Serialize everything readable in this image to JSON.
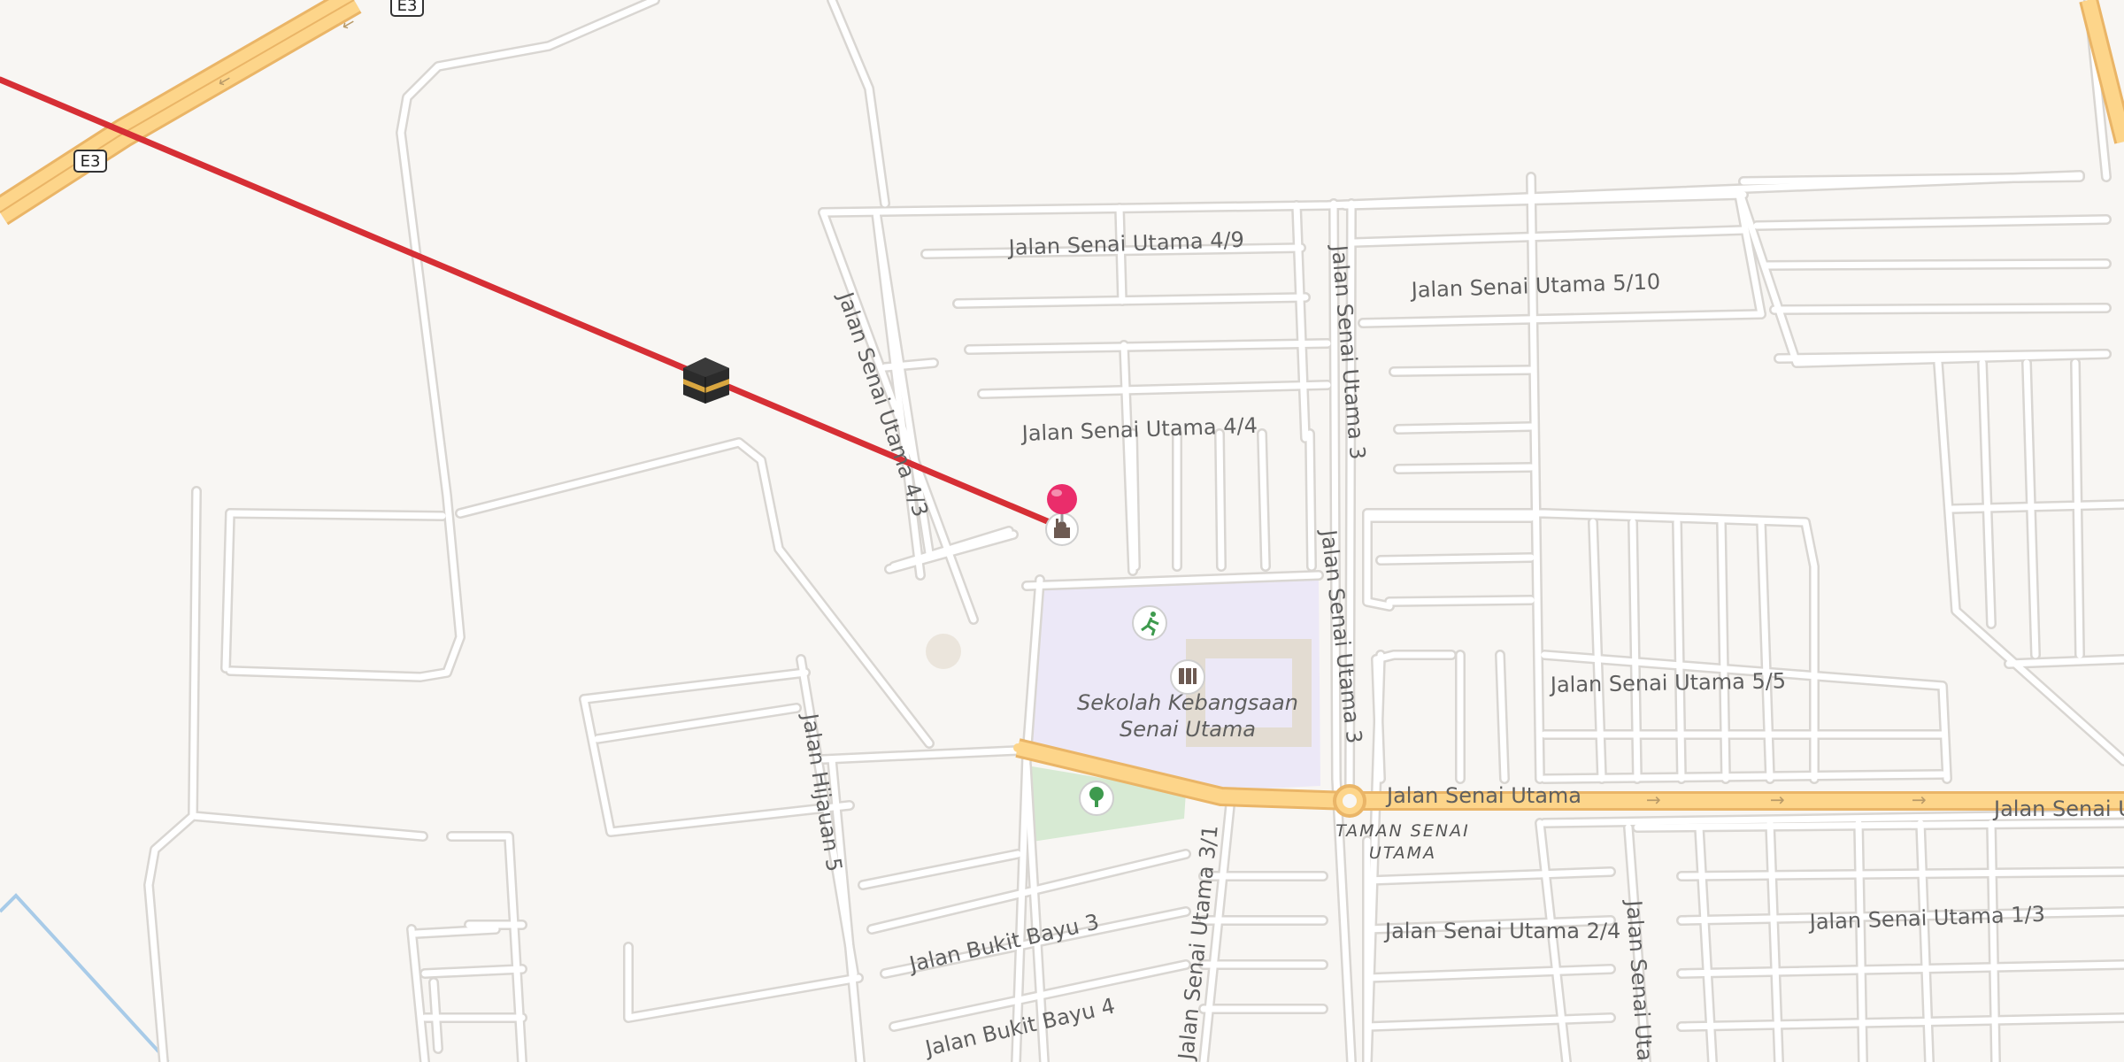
{
  "map": {
    "colors": {
      "background": "#f8f6f3",
      "road": "#ffffff",
      "road_casing": "#dcd9d5",
      "highway": "#fdd58a",
      "highway_casing": "#eab567",
      "school_area": "#ece8f7",
      "park": "#d7ead3",
      "route_line": "#d62f35",
      "boundary": "#a8cbe8",
      "pin": "#ea2d6b"
    },
    "highway_shields": [
      "E3",
      "E3"
    ],
    "street_labels": {
      "senai_utama_4_9": "Jalan Senai Utama 4/9",
      "senai_utama_5_10": "Jalan Senai Utama 5/10",
      "senai_utama_4_4": "Jalan Senai Utama 4/4",
      "senai_utama_4_3": "Jalan Senai Utama 4/3",
      "senai_utama_3_a": "Jalan Senai Utama 3",
      "senai_utama_3_b": "Jalan Senai Utama 3",
      "senai_utama_5_5": "Jalan Senai Utama 5/5",
      "senai_utama_a": "Jalan Senai Utama",
      "senai_utama_b": "Jalan Senai Utama",
      "hijauan_5": "Jalan Hijauan 5",
      "senai_utama_2_4": "Jalan Senai Utama 2/4",
      "senai_utama_1_3": "Jalan Senai Utama 1/3",
      "bukit_bayu_3": "Jalan Bukit Bayu 3",
      "bukit_bayu_4": "Jalan Bukit Bayu 4",
      "senai_utama_3_1": "Jalan Senai Utama 3/1",
      "senai_utama_2_cut": "Jalan Senai Utama"
    },
    "places": {
      "school_line1": "Sekolah Kebangsaan",
      "school_line2": "Senai Utama",
      "area_line1": "TAMAN SENAI",
      "area_line2": "UTAMA"
    },
    "icons": [
      "kaaba-icon",
      "mosque-icon",
      "map-pin-icon",
      "running-icon",
      "school-icon",
      "tree-icon"
    ]
  }
}
